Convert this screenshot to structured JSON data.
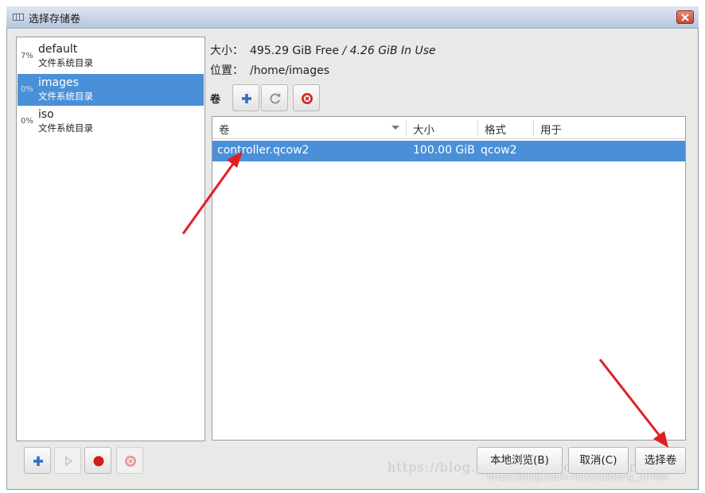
{
  "window": {
    "title": "选择存储卷",
    "close_label": "x"
  },
  "pools": [
    {
      "pct": "7%",
      "name": "default",
      "type": "文件系统目录",
      "selected": false
    },
    {
      "pct": "0%",
      "name": "images",
      "type": "文件系统目录",
      "selected": true
    },
    {
      "pct": "0%",
      "name": "iso",
      "type": "文件系统目录",
      "selected": false
    }
  ],
  "info": {
    "size_label": "大小：",
    "size_free": "495.29 GiB Free",
    "size_sep": " / ",
    "size_inuse": "4.26 GiB In Use",
    "location_label": "位置：",
    "location_value": "/home/images"
  },
  "volumes_toolbar": {
    "label": "卷",
    "buttons": [
      "add-volume",
      "refresh-volumes",
      "delete-volume"
    ]
  },
  "volume_table": {
    "columns": [
      "卷",
      "大小",
      "格式",
      "用于"
    ],
    "rows": [
      {
        "name": "controller.qcow2",
        "size": "100.00 GiB",
        "format": "qcow2",
        "used_by": ""
      }
    ]
  },
  "buttons": {
    "browse_local": "本地浏览(B)",
    "cancel": "取消(C)",
    "choose_volume": "选择卷"
  },
  "watermark": {
    "text": "https://blog.csdn.net/xiaopeng_thriller",
    "text2": "https://blog.csdn.net/xiaopeng_thriller"
  },
  "colors": {
    "selection": "#4a90d9",
    "annotation_arrow": "#e02020"
  }
}
